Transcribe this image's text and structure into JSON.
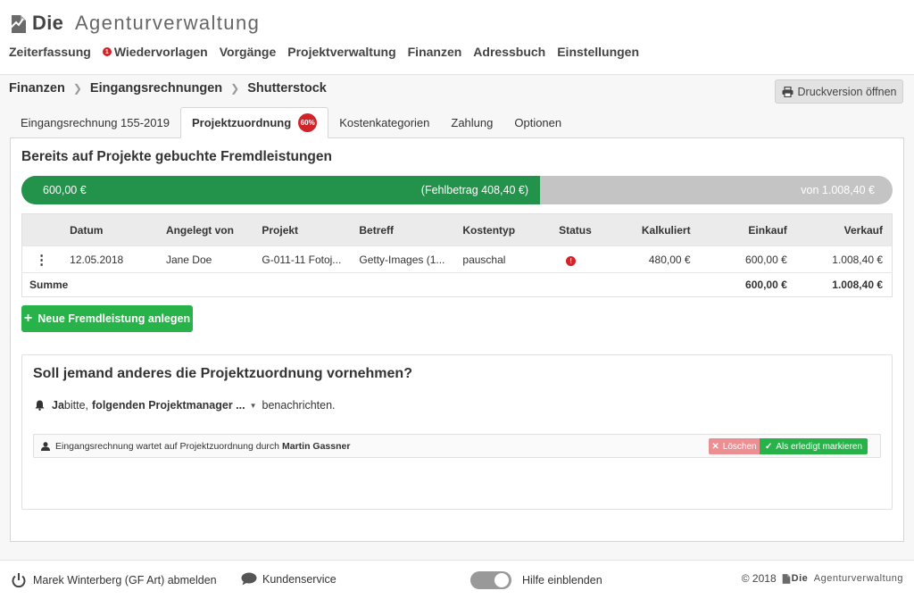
{
  "app": {
    "logo_die": "Die",
    "logo_rest": "Agenturverwaltung"
  },
  "nav": {
    "items": [
      {
        "label": "Zeiterfassung"
      },
      {
        "label": "Wiedervorlagen",
        "badge": "1"
      },
      {
        "label": "Vorgänge"
      },
      {
        "label": "Projektverwaltung"
      },
      {
        "label": "Finanzen"
      },
      {
        "label": "Adressbuch"
      },
      {
        "label": "Einstellungen"
      }
    ]
  },
  "breadcrumb": [
    "Finanzen",
    "Eingangsrechnungen",
    "Shutterstock"
  ],
  "print_button": "Druckversion öffnen",
  "tabs": [
    {
      "label": "Eingangsrechnung 155-2019"
    },
    {
      "label": "Projektzuordnung",
      "badge": "60%",
      "active": true
    },
    {
      "label": "Kostenkategorien"
    },
    {
      "label": "Zahlung"
    },
    {
      "label": "Optionen"
    }
  ],
  "section_title": "Bereits auf Projekte gebuchte Fremdleistungen",
  "progress": {
    "fraction": 0.595,
    "left_label": "600,00 €",
    "mid_label": "(Fehlbetrag 408,40 €)",
    "right_label": "von 1.008,40 €"
  },
  "table": {
    "headers": [
      "",
      "Datum",
      "Angelegt von",
      "Projekt",
      "Betreff",
      "Kostentyp",
      "Status",
      "Kalkuliert",
      "Einkauf",
      "Verkauf"
    ],
    "rows": [
      {
        "datum": "12.05.2018",
        "angelegt_von": "Jane Doe",
        "projekt": "G-011-11 Fotoj...",
        "betreff": "Getty-Images (1...",
        "kostentyp": "pauschal",
        "status_icon": "!",
        "kalkuliert": "480,00 €",
        "einkauf": "600,00 €",
        "verkauf": "1.008,40 €"
      }
    ],
    "sum_label": "Summe",
    "sum_einkauf": "600,00 €",
    "sum_verkauf": "1.008,40 €"
  },
  "add_button": "Neue Fremdleistung anlegen",
  "assign": {
    "title": "Soll jemand anderes die Projektzuordnung vornehmen?",
    "ja": "Ja",
    "bitte": " bitte,",
    "dropdown": "folgenden Projektmanager ...",
    "suffix": "benachrichten.",
    "wait_text": "Eingangsrechnung wartet auf Projektzuordnung durch",
    "wait_person": "Martin Gassner",
    "delete_label": "Löschen",
    "done_label": "Als erledigt markieren"
  },
  "footer": {
    "logout": "Marek Winterberg (GF Art) abmelden",
    "support": "Kundenservice",
    "help": "Hilfe einblenden",
    "copyright": "© 2018"
  }
}
